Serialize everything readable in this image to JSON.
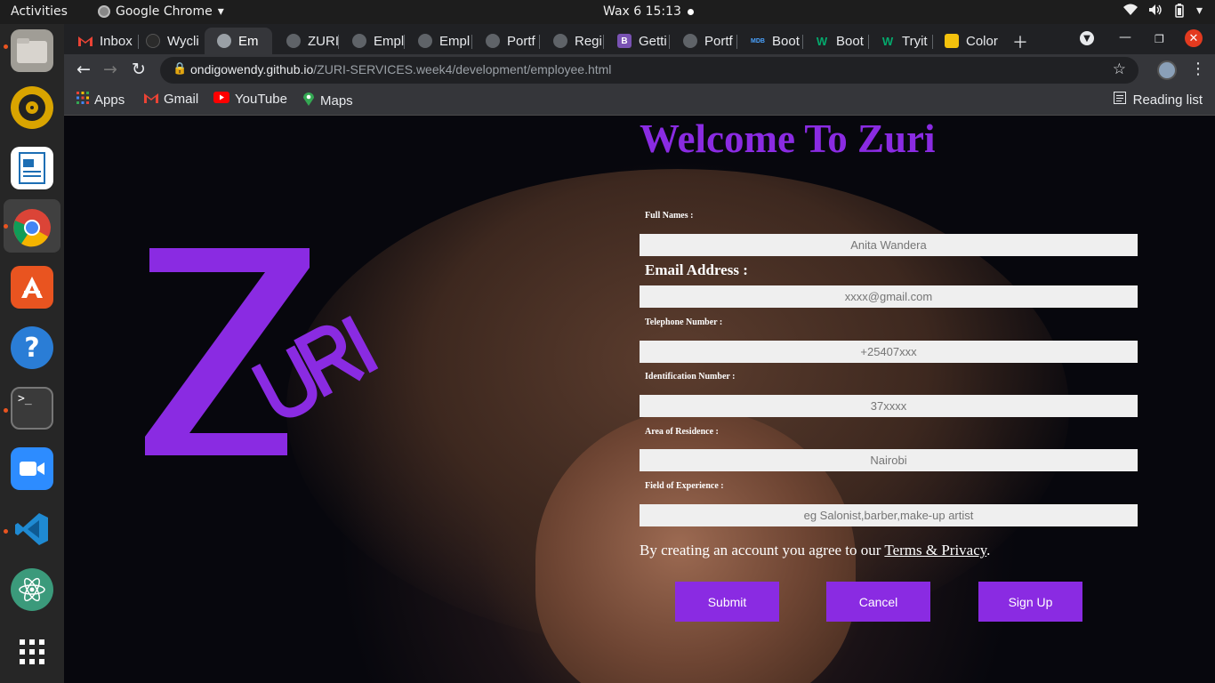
{
  "system": {
    "activities": "Activities",
    "app_name": "Google Chrome",
    "clock": "Wax 6  15:13"
  },
  "browser": {
    "tabs": [
      {
        "label": "Inbox",
        "favicon": "gmail-icon"
      },
      {
        "label": "Wycli",
        "favicon": "github-icon"
      },
      {
        "label": "Em",
        "favicon": "globe-icon",
        "active": true
      },
      {
        "label": "ZURI",
        "favicon": "globe-icon"
      },
      {
        "label": "Empl",
        "favicon": "globe-icon"
      },
      {
        "label": "Empl",
        "favicon": "globe-icon"
      },
      {
        "label": "Portf",
        "favicon": "globe-icon"
      },
      {
        "label": "Regi",
        "favicon": "globe-icon"
      },
      {
        "label": "Getti",
        "favicon": "bootstrap-icon"
      },
      {
        "label": "Portf",
        "favicon": "globe-icon"
      },
      {
        "label": "Boot",
        "favicon": "mdb-icon"
      },
      {
        "label": "Boot",
        "favicon": "w-icon"
      },
      {
        "label": "Tryit",
        "favicon": "w-icon"
      },
      {
        "label": "Color",
        "favicon": "color-icon"
      }
    ],
    "url_host": "ondigowendy.github.io",
    "url_path": "/ZURI-SERVICES.week4/development/employee.html",
    "bookmarks": [
      {
        "label": "Apps"
      },
      {
        "label": "Gmail"
      },
      {
        "label": "YouTube"
      },
      {
        "label": "Maps"
      }
    ],
    "reading_list": "Reading list"
  },
  "page": {
    "heading": "Welcome To Zuri",
    "brand_color": "#8a2be2",
    "fields": [
      {
        "label": "Full Names :",
        "placeholder": "Anita Wandera"
      },
      {
        "label": "Email Address :",
        "placeholder": "xxxx@gmail.com"
      },
      {
        "label": "Telephone Number :",
        "placeholder": "+25407xxx"
      },
      {
        "label": "Identification Number :",
        "placeholder": "37xxxx"
      },
      {
        "label": "Area of Residence :",
        "placeholder": "Nairobi"
      },
      {
        "label": "Field of Experience :",
        "placeholder": "eg Salonist,barber,make-up artist"
      }
    ],
    "agree_text": "By creating an account you agree to our ",
    "agree_link": "Terms & Privacy",
    "agree_end": ".",
    "buttons": {
      "submit": "Submit",
      "cancel": "Cancel",
      "signup": "Sign Up"
    }
  }
}
